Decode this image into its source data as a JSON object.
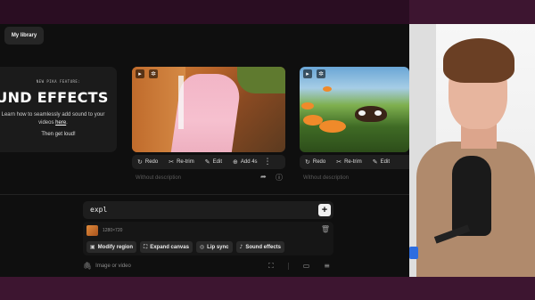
{
  "library": {
    "label": "My library"
  },
  "promo": {
    "kicker": "NEW PIKA FEATURE:",
    "headline": "UND EFFECTS",
    "desc_prefix": "Learn how to seamlessly add sound to your videos ",
    "desc_link": "here",
    "desc_suffix": ".",
    "cta": "Then get loud!"
  },
  "videos": [
    {
      "toolbar": [
        {
          "icon": "↻",
          "icon_name": "redo-icon",
          "label": "Redo"
        },
        {
          "icon": "✂",
          "icon_name": "retrim-icon",
          "label": "Re-trim"
        },
        {
          "icon": "✎",
          "icon_name": "edit-icon",
          "label": "Edit"
        },
        {
          "icon": "⊕",
          "icon_name": "add-time-icon",
          "label": "Add 4s"
        }
      ],
      "description": "Without description"
    },
    {
      "toolbar": [
        {
          "icon": "↻",
          "icon_name": "redo-icon",
          "label": "Redo"
        },
        {
          "icon": "✂",
          "icon_name": "retrim-icon",
          "label": "Re-trim"
        },
        {
          "icon": "✎",
          "icon_name": "edit-icon",
          "label": "Edit"
        }
      ],
      "description": "Without description"
    }
  ],
  "prompt": {
    "value": "expl",
    "plus": "+"
  },
  "panel": {
    "resolution": "1280×720",
    "chips": [
      {
        "icon": "▣",
        "icon_name": "modify-region-icon",
        "label": "Modify region"
      },
      {
        "icon": "⛶",
        "icon_name": "expand-canvas-icon",
        "label": "Expand canvas"
      },
      {
        "icon": "◎",
        "icon_name": "lip-sync-icon",
        "label": "Lip sync"
      },
      {
        "icon": "♪",
        "icon_name": "sound-effects-icon",
        "label": "Sound effects"
      }
    ]
  },
  "bottom": {
    "attach_label": "Image or video"
  }
}
